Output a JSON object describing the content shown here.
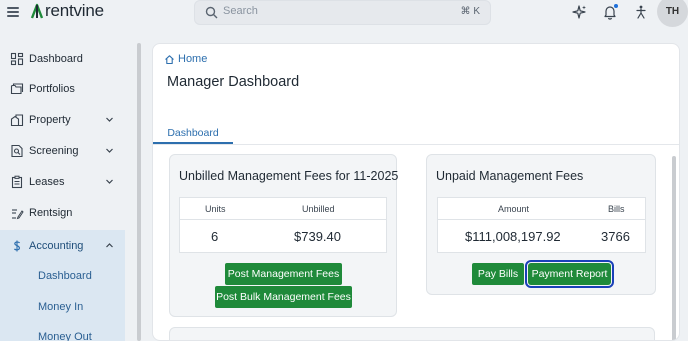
{
  "app": {
    "brand": "rentvine",
    "brand_color": "#1f8a3a"
  },
  "topbar": {
    "search_placeholder": "Search",
    "search_shortcut": "⌘ K",
    "icons": [
      "menu-icon",
      "sparkle-icon",
      "bell-icon",
      "accessibility-icon"
    ],
    "avatar_initials": "TH"
  },
  "sidebar": {
    "items": [
      {
        "label": "Dashboard",
        "icon": "grid-icon"
      },
      {
        "label": "Portfolios",
        "icon": "folder-icon"
      },
      {
        "label": "Property",
        "icon": "building-icon",
        "expandable": true
      },
      {
        "label": "Screening",
        "icon": "screening-icon",
        "expandable": true
      },
      {
        "label": "Leases",
        "icon": "clipboard-icon",
        "expandable": true
      },
      {
        "label": "Rentsign",
        "icon": "sign-icon"
      },
      {
        "label": "Accounting",
        "icon": "dollar-icon",
        "expandable": true,
        "expanded": true
      }
    ],
    "accounting_sub": [
      {
        "label": "Dashboard"
      },
      {
        "label": "Money In"
      },
      {
        "label": "Money Out"
      }
    ]
  },
  "main": {
    "breadcrumb": "Home",
    "title": "Manager Dashboard",
    "tabs": [
      {
        "label": "Dashboard",
        "active": true
      }
    ],
    "unbilled_card": {
      "title": "Unbilled Management Fees for 11-2025",
      "headers": [
        "Units",
        "Unbilled"
      ],
      "values": [
        "6",
        "$739.40"
      ],
      "buttons": [
        "Post Management Fees",
        "Post Bulk Management Fees"
      ]
    },
    "unpaid_card": {
      "title": "Unpaid Management Fees",
      "headers": [
        "Amount",
        "Bills"
      ],
      "values": [
        "$111,008,197.92",
        "3766"
      ],
      "buttons": [
        "Pay Bills",
        "Payment Report"
      ]
    }
  },
  "colors": {
    "accent": "#2d6fae",
    "button_green": "#1f8a3a",
    "focus_ring": "#1a40b8",
    "sidebar_active_bg": "#dbe7f2"
  }
}
